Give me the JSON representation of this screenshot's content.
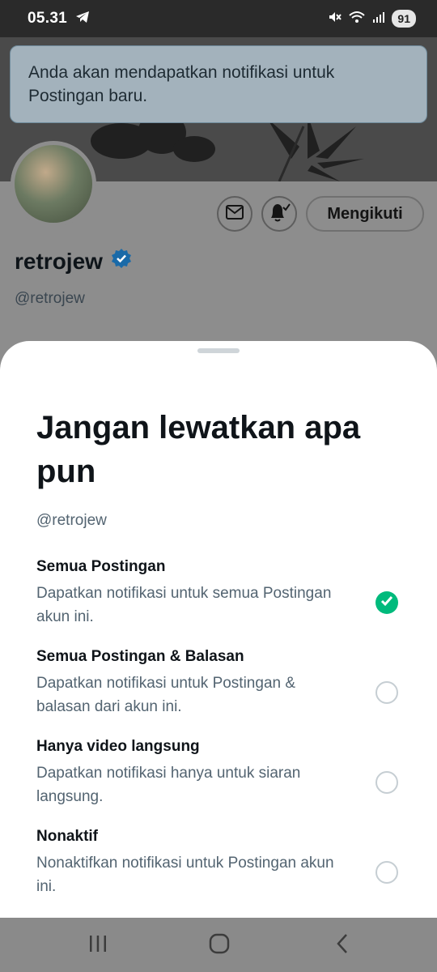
{
  "status": {
    "time": "05.31",
    "battery": "91",
    "icons": [
      "telegram-icon",
      "mute-icon",
      "wifi-icon",
      "signal-icon"
    ]
  },
  "toast": {
    "text": "Anda akan mendapatkan notifikasi untuk Postingan baru."
  },
  "profile": {
    "name": "retrojew",
    "handle": "@retrojew",
    "follow_label": "Mengikuti",
    "verified": true
  },
  "sheet": {
    "title": "Jangan lewatkan apa pun",
    "handle": "@retrojew",
    "options": [
      {
        "title": "Semua Postingan",
        "desc": "Dapatkan notifikasi untuk semua Postingan akun ini.",
        "selected": true
      },
      {
        "title": "Semua Postingan & Balasan",
        "desc": "Dapatkan notifikasi untuk Postingan & balasan dari akun ini.",
        "selected": false
      },
      {
        "title": "Hanya video langsung",
        "desc": "Dapatkan notifikasi hanya untuk siaran langsung.",
        "selected": false
      },
      {
        "title": "Nonaktif",
        "desc": "Nonaktifkan notifikasi untuk Postingan akun ini.",
        "selected": false
      }
    ]
  },
  "colors": {
    "accent_green": "#00ba7c",
    "verified_blue": "#1d9bf0",
    "text_primary": "#0f1419",
    "text_secondary": "#536471"
  }
}
